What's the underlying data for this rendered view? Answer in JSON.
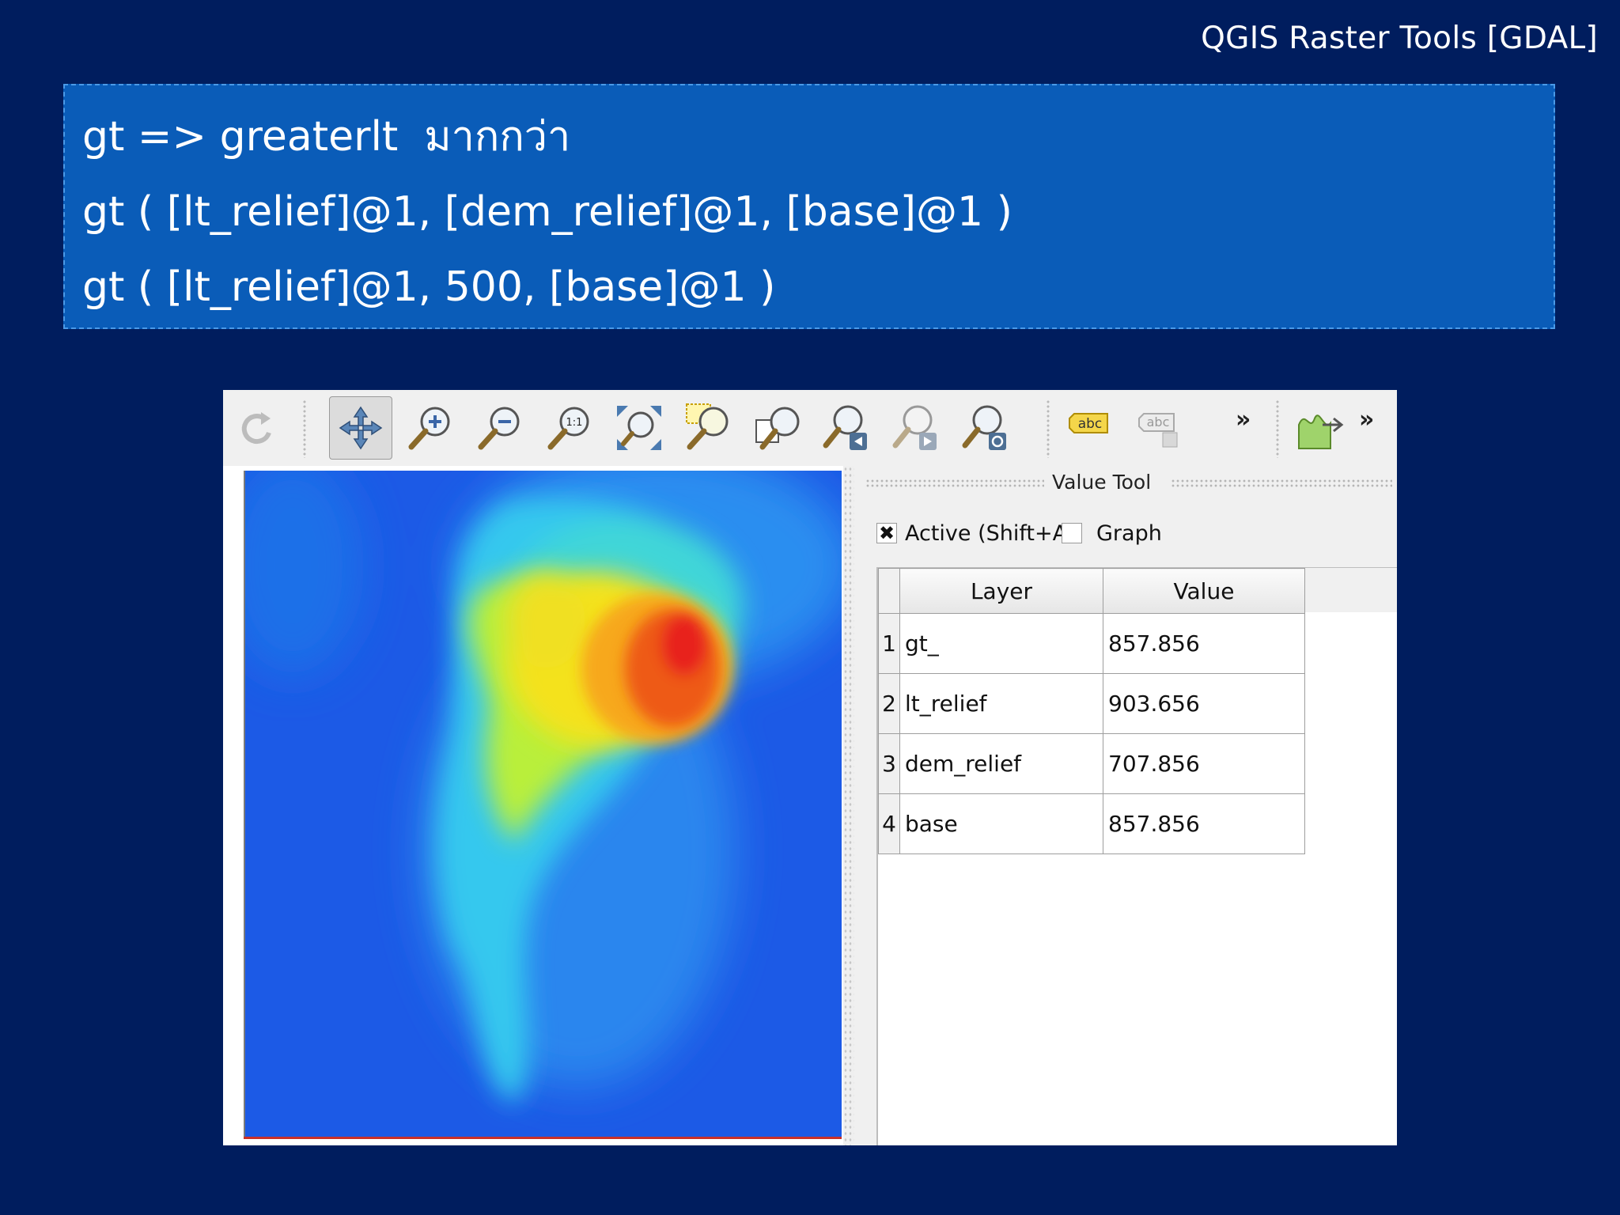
{
  "slide": {
    "title": "QGIS Raster Tools [GDAL]",
    "code_lines": [
      "gt => greaterlt  มากกว่า",
      "gt ( [lt_relief]@1, [dem_relief]@1, [base]@1 )",
      "gt ( [lt_relief]@1, 500, [base]@1 )"
    ]
  },
  "toolbar": {
    "icons": [
      "refresh-icon",
      "pan-icon",
      "zoom-in-icon",
      "zoom-out-icon",
      "zoom-native-icon",
      "zoom-full-icon",
      "zoom-selection-icon",
      "zoom-layer-icon",
      "zoom-last-icon",
      "zoom-next-icon",
      "refresh-map-icon",
      "label-icon",
      "label-pin-icon",
      "value-tool-icon"
    ],
    "label_icon_text": "abc",
    "label_pin_icon_text": "abc",
    "zoom_native_text": "1:1",
    "overflow_1": "»",
    "overflow_2": "»"
  },
  "value_tool": {
    "title": "Value Tool",
    "active_label": "Active (Shift+A)",
    "active_checked": true,
    "active_mark": "✖",
    "graph_label": "Graph",
    "graph_checked": false,
    "columns": [
      "Layer",
      "Value"
    ],
    "rows": [
      {
        "index": "1",
        "layer": "gt_",
        "value": "857.856"
      },
      {
        "index": "2",
        "layer": "lt_relief",
        "value": "903.656"
      },
      {
        "index": "3",
        "layer": "dem_relief",
        "value": "707.856"
      },
      {
        "index": "4",
        "layer": "base",
        "value": "857.856"
      }
    ]
  },
  "colors": {
    "background": "#001d5e",
    "code_box": "#0a5cb8",
    "raster_low": "#1c5ae6",
    "raster_high": "#e8201a"
  }
}
